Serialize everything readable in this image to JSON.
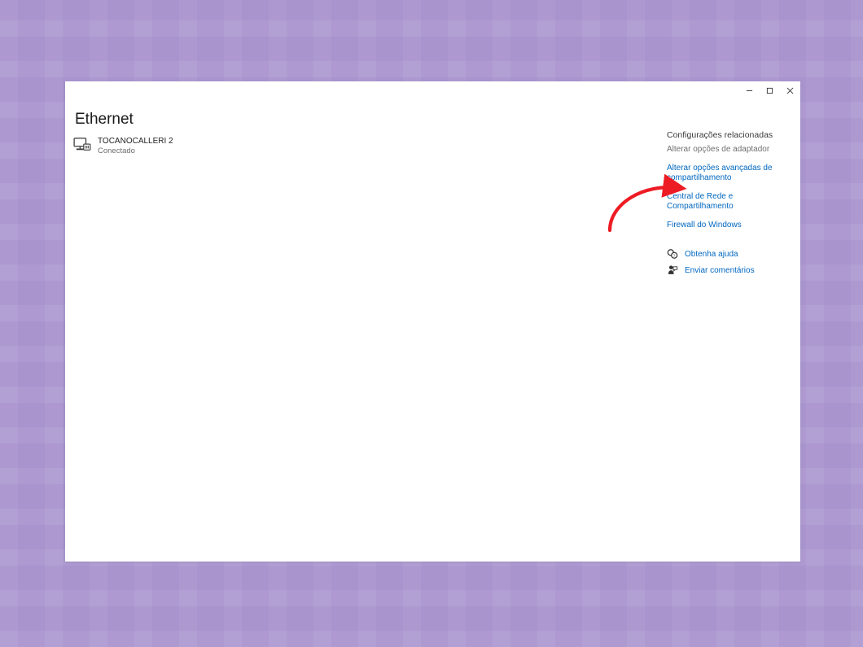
{
  "page": {
    "title": "Ethernet"
  },
  "network": {
    "name": "TOCANOCALLERI 2",
    "status": "Conectado"
  },
  "sidebar": {
    "heading": "Configurações relacionadas",
    "items": [
      {
        "label": "Alterar opções de adaptador",
        "type": "dim"
      },
      {
        "label": "Alterar opções avançadas de compartilhamento",
        "type": "link"
      },
      {
        "label": "Central de Rede e Compartilhamento",
        "type": "link"
      },
      {
        "label": "Firewall do Windows",
        "type": "link"
      }
    ],
    "help": [
      {
        "label": "Obtenha ajuda",
        "icon": "help"
      },
      {
        "label": "Enviar comentários",
        "icon": "feedback"
      }
    ]
  },
  "annotation": {
    "target": "Central de Rede e Compartilhamento",
    "color": "#ed1c24"
  }
}
